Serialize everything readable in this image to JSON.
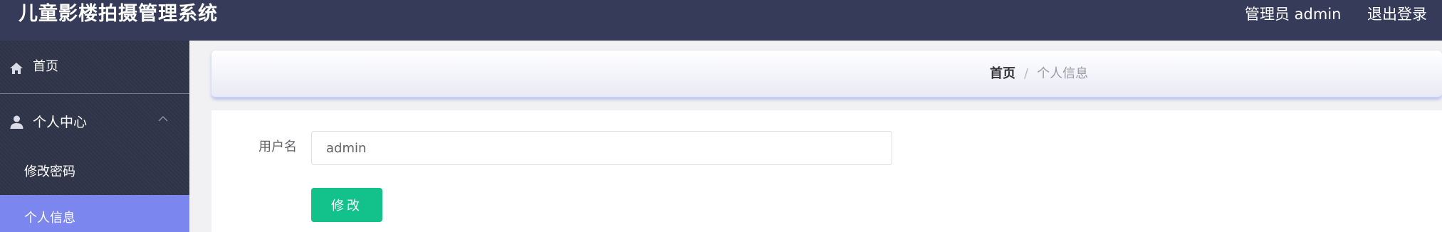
{
  "header": {
    "title": "儿童影楼拍摄管理系统",
    "user": "管理员 admin",
    "logout": "退出登录"
  },
  "sidebar": {
    "home": {
      "label": "首页",
      "icon": "home-icon"
    },
    "personal_center": {
      "label": "个人中心",
      "icon": "user-icon",
      "expanded": true,
      "children": [
        {
          "label": "修改密码",
          "active": false
        },
        {
          "label": "个人信息",
          "active": true
        }
      ]
    }
  },
  "breadcrumb": {
    "home": "首页",
    "separator": "/",
    "current": "个人信息"
  },
  "form": {
    "username_label": "用户名",
    "username_value": "admin",
    "submit_label": "修改"
  },
  "colors": {
    "topbar": "#353b58",
    "sidebar": "#2f3548",
    "active_item": "#7b86ee",
    "primary_button": "#13c18b"
  }
}
